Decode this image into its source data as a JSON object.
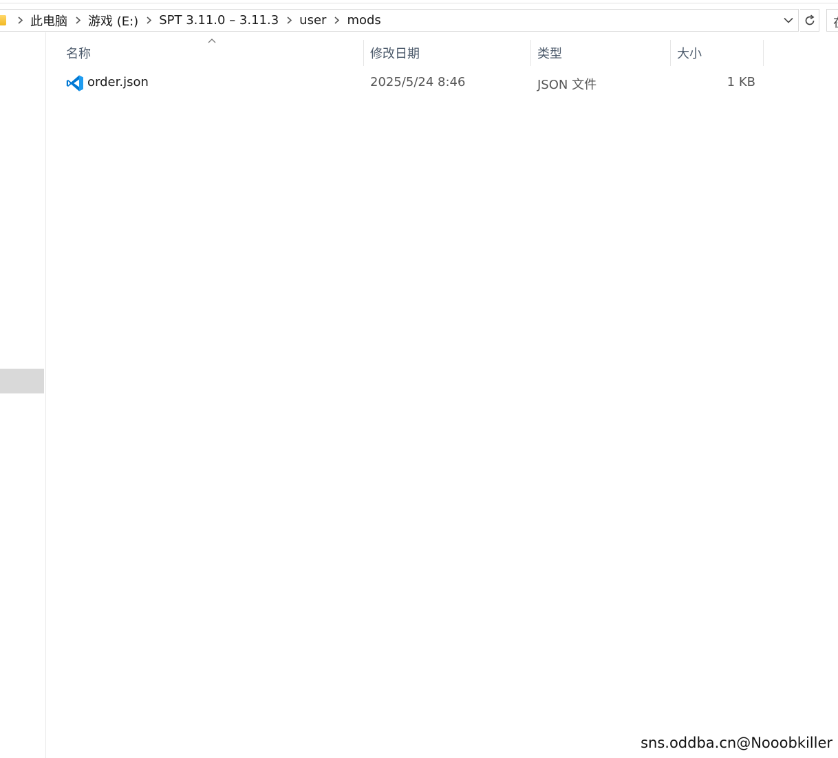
{
  "address": {
    "breadcrumbs": [
      "此电脑",
      "游戏 (E:)",
      "SPT 3.11.0 – 3.11.3",
      "user",
      "mods"
    ]
  },
  "search": {
    "partial_text": "在"
  },
  "columns": {
    "name": "名称",
    "date": "修改日期",
    "type": "类型",
    "size": "大小"
  },
  "files": [
    {
      "name": "order.json",
      "date": "2025/5/24 8:46",
      "type": "JSON 文件",
      "size": "1 KB",
      "icon": "vscode-icon"
    }
  ],
  "watermark": "sns.oddba.cn@Nooobkiller",
  "colors": {
    "vscode_blue": "#0078d4",
    "folder_yellow": "#f2b823"
  }
}
